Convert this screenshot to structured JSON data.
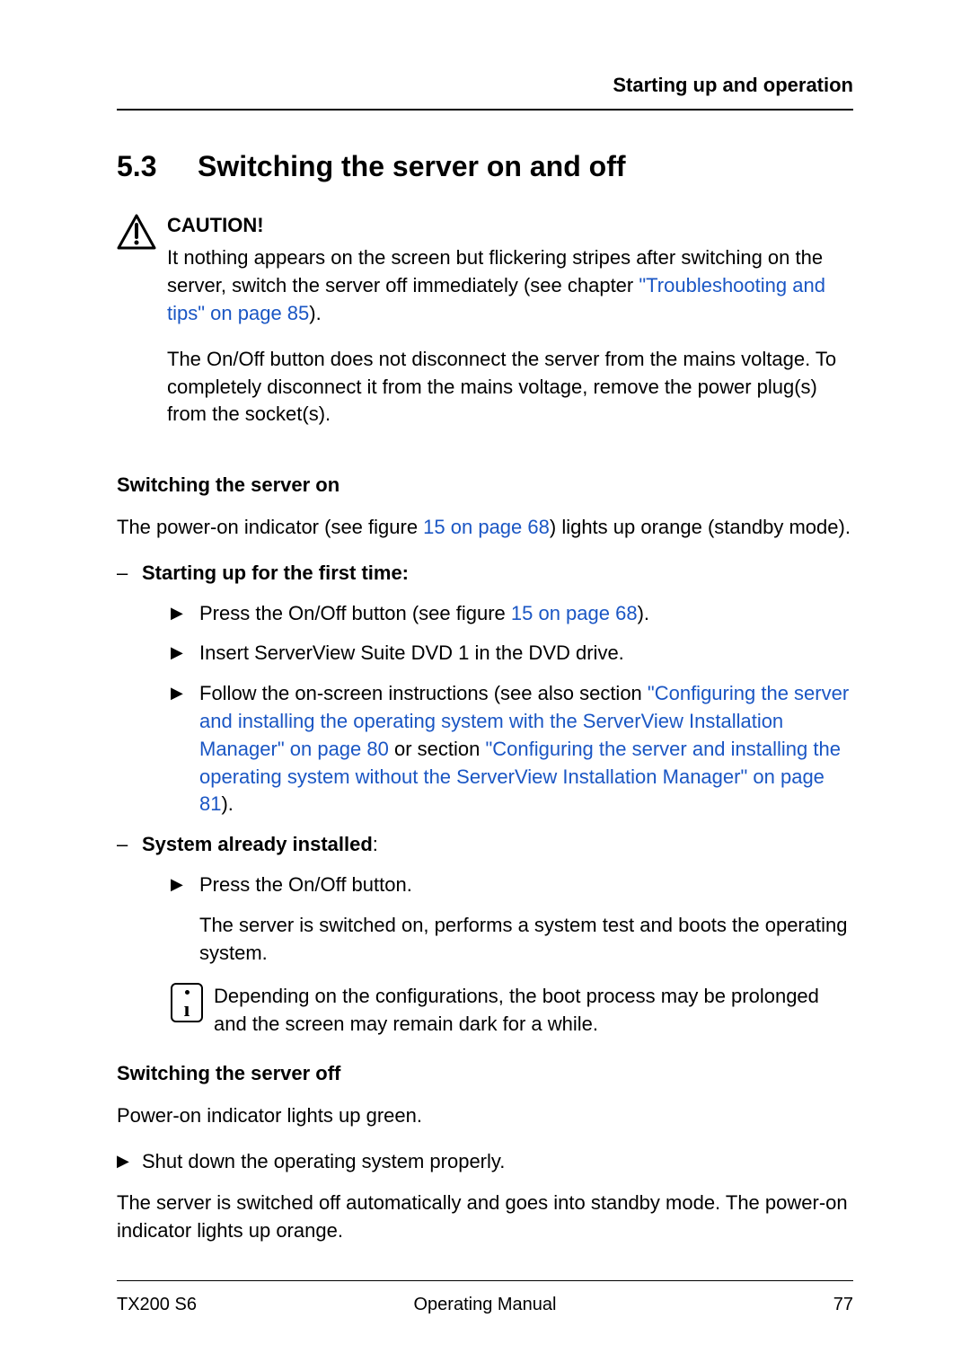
{
  "runningHead": "Starting up and operation",
  "sectionNumber": "5.3",
  "sectionTitle": "Switching the server on and off",
  "caution": {
    "label": "CAUTION!",
    "p1a": "It nothing appears on the screen but flickering stripes after switching on the server, switch the server off immediately (see chapter ",
    "p1link": "\"Troubleshooting and tips\" on page 85",
    "p1b": ").",
    "p2": "The On/Off button does not disconnect the server from the mains voltage. To completely disconnect it from the mains voltage, remove the power plug(s) from the socket(s)."
  },
  "switchOn": {
    "heading": "Switching the server on",
    "introA": "The power-on indicator (see figure ",
    "introLink": "15 on page 68",
    "introB": ") lights up orange (standby mode).",
    "firstTime": {
      "label": "Starting up for the first time:",
      "step1a": "Press the On/Off button (see figure ",
      "step1link": "15 on page 68",
      "step1b": ").",
      "step2": "Insert ServerView Suite DVD 1 in the DVD drive.",
      "step3a": "Follow the on-screen instructions (see also section ",
      "step3link1": "\"Configuring the server and installing the operating system with the ServerView Installation Manager\" on page 80",
      "step3mid": " or section ",
      "step3link2": "\"Configuring the server and installing the operating system without the ServerView Installation Manager\" on page 81",
      "step3b": ")."
    },
    "installed": {
      "label": "System already installed",
      "labelColon": ":",
      "step1": "Press the On/Off button.",
      "result": "The server is switched on, performs a system test and boots the operating system.",
      "info": "Depending on the configurations, the boot process may be prolonged and the screen may remain dark for a while."
    }
  },
  "switchOff": {
    "heading": "Switching the server off",
    "intro": "Power-on indicator lights up green.",
    "step1": "Shut down the operating system properly.",
    "result": "The server is switched off automatically and goes into standby mode. The power-on indicator lights up orange."
  },
  "footer": {
    "left": "TX200 S6",
    "center": "Operating Manual",
    "right": "77"
  }
}
